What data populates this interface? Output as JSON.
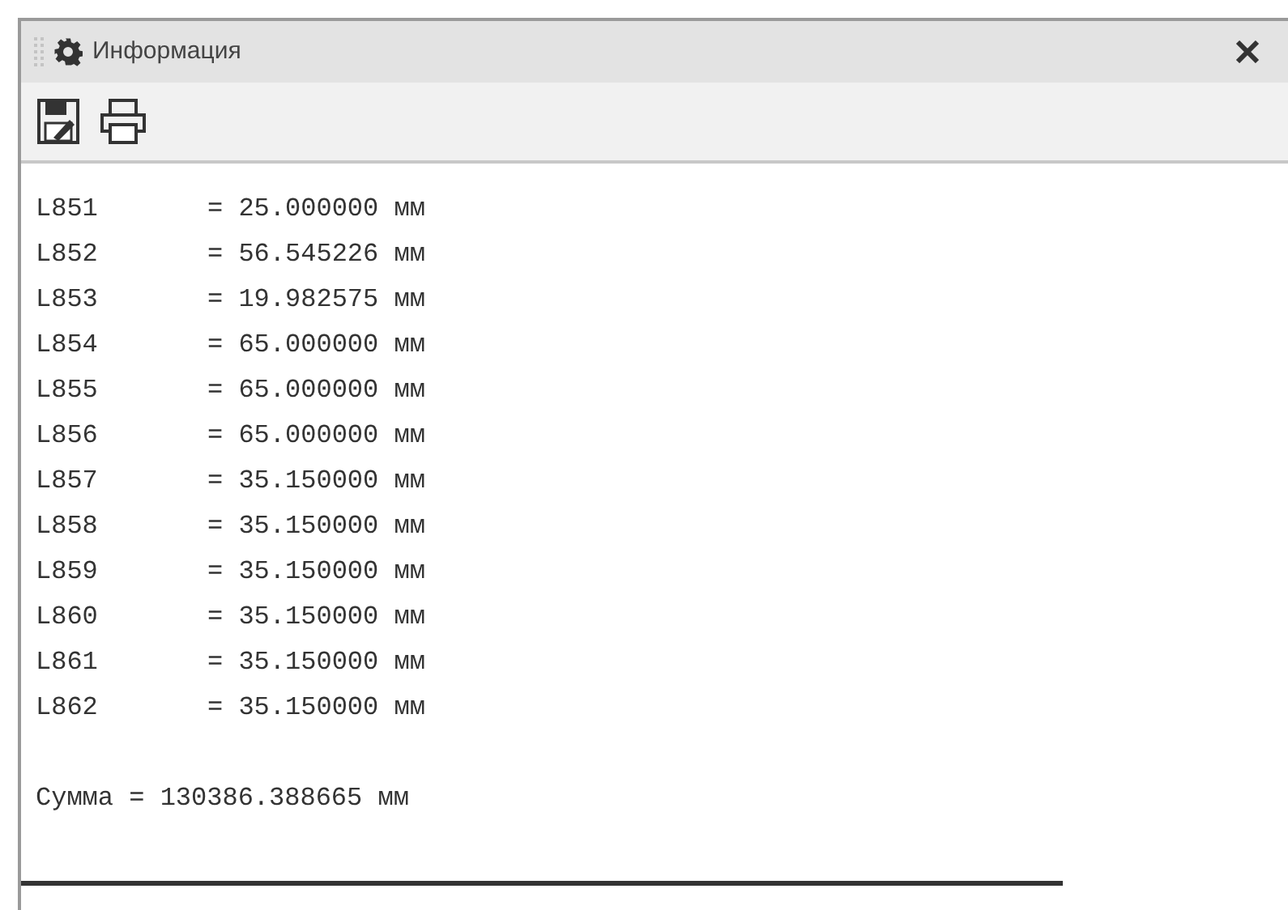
{
  "window": {
    "title": "Информация"
  },
  "toolbar": {
    "buttons": [
      {
        "kind": "save"
      },
      {
        "kind": "print"
      }
    ]
  },
  "lines": [
    {
      "name": "L851",
      "value": "= 25.000000 мм"
    },
    {
      "name": "L852",
      "value": "= 56.545226 мм"
    },
    {
      "name": "L853",
      "value": "= 19.982575 мм"
    },
    {
      "name": "L854",
      "value": "= 65.000000 мм"
    },
    {
      "name": "L855",
      "value": "= 65.000000 мм"
    },
    {
      "name": "L856",
      "value": "= 65.000000 мм"
    },
    {
      "name": "L857",
      "value": "= 35.150000 мм"
    },
    {
      "name": "L858",
      "value": "= 35.150000 мм"
    },
    {
      "name": "L859",
      "value": "= 35.150000 мм"
    },
    {
      "name": "L860",
      "value": "= 35.150000 мм"
    },
    {
      "name": "L861",
      "value": "= 35.150000 мм"
    },
    {
      "name": "L862",
      "value": "= 35.150000 мм"
    }
  ],
  "total": "Сумма = 130386.388665 мм"
}
